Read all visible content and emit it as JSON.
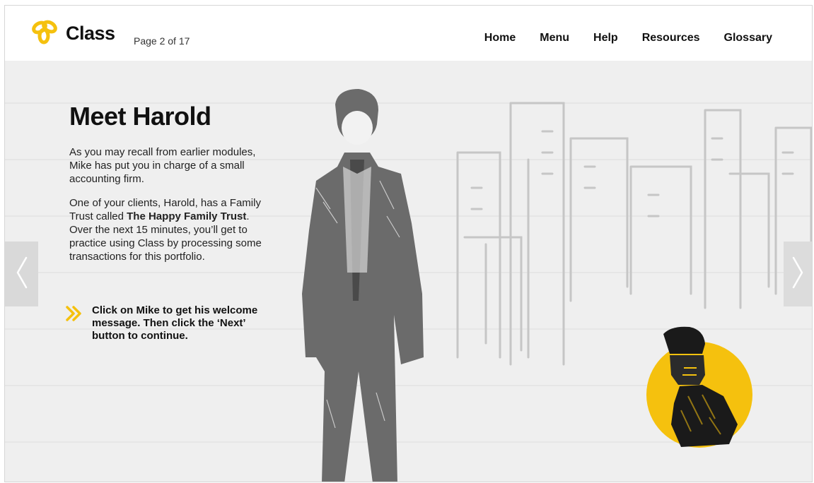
{
  "header": {
    "logo_text": "Class",
    "page_counter": "Page 2 of 17",
    "nav": [
      "Home",
      "Menu",
      "Help",
      "Resources",
      "Glossary"
    ]
  },
  "main": {
    "title": "Meet Harold",
    "para1": "As you may recall from earlier modules, Mike has put you in charge of a small accounting firm.",
    "para2_a": "One of your clients, Harold, has a Family Trust called ",
    "para2_bold": "The Happy Family Trust",
    "para2_b": ". Over the next 15 minutes, you’ll get to practice using Class by processing some transactions for this portfolio.",
    "instruction": "Click on Mike to get his welcome message. Then click the ‘Next’ button to continue."
  },
  "colors": {
    "accent": "#f5c10e",
    "figure": "#6b6b6b",
    "background": "#efefef"
  },
  "icons": {
    "logo": "class-logo-icon",
    "instruction": "double-chevron-right-icon",
    "prev": "chevron-left-icon",
    "next": "chevron-right-icon"
  }
}
